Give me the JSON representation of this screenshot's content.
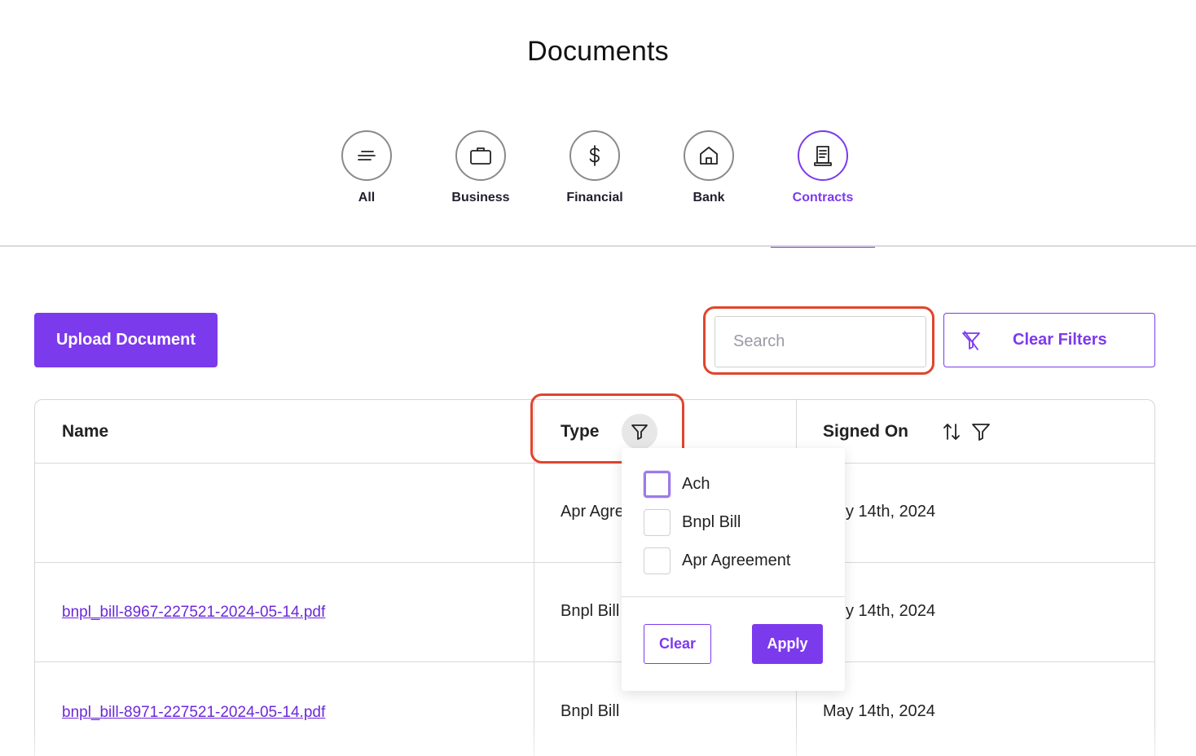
{
  "page": {
    "title": "Documents"
  },
  "categories": [
    {
      "label": "All",
      "icon": "list-icon",
      "active": false
    },
    {
      "label": "Business",
      "icon": "briefcase-icon",
      "active": false
    },
    {
      "label": "Financial",
      "icon": "dollar-icon",
      "active": false
    },
    {
      "label": "Bank",
      "icon": "house-icon",
      "active": false
    },
    {
      "label": "Contracts",
      "icon": "receipt-icon",
      "active": true
    }
  ],
  "toolbar": {
    "upload_label": "Upload Document",
    "search_placeholder": "Search",
    "search_value": "",
    "clear_filters_label": "Clear Filters"
  },
  "table": {
    "columns": [
      "Name",
      "Type",
      "Signed On"
    ],
    "rows": [
      {
        "name": "",
        "type": "Apr Agre",
        "signed_on": "y 14th, 2024"
      },
      {
        "name": "bnpl_bill-8967-227521-2024-05-14.pdf",
        "type": "Bnpl Bill",
        "signed_on": "y 14th, 2024"
      },
      {
        "name": "bnpl_bill-8971-227521-2024-05-14.pdf",
        "type": "Bnpl Bill",
        "signed_on": "May 14th, 2024"
      }
    ]
  },
  "type_filter": {
    "options": [
      {
        "label": "Ach",
        "checked": false
      },
      {
        "label": "Bnpl Bill",
        "checked": false
      },
      {
        "label": "Apr Agreement",
        "checked": false
      }
    ],
    "clear_label": "Clear",
    "apply_label": "Apply"
  },
  "colors": {
    "accent": "#7c3aed",
    "highlight": "#e0452d"
  }
}
